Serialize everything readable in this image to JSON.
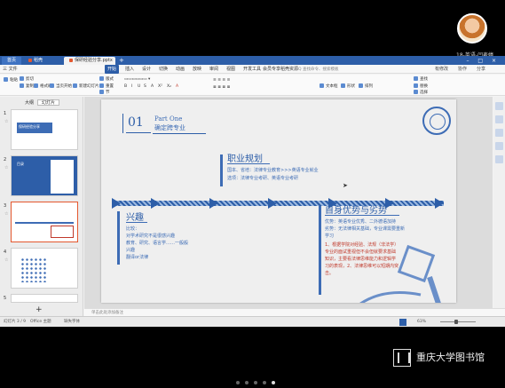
{
  "viewer": {
    "avatar_name": "18-英语-闫麦婷",
    "library_name": "重庆大学图书馆"
  },
  "tabs": {
    "home": "首页",
    "t1": "稻壳",
    "t2": "保研经验分享.pptx"
  },
  "menu": {
    "file": "三 文件",
    "items": [
      "开始",
      "插入",
      "设计",
      "切换",
      "动画",
      "放映",
      "审阅",
      "视图",
      "开发工具",
      "会员专享",
      "稻壳资源"
    ],
    "active": "开始",
    "search_placeholder": "Q 查找命令、搜索模板",
    "right": [
      "有修改",
      "协作",
      "分享"
    ]
  },
  "ribbon": {
    "row1": [
      "粘贴",
      "剪切",
      "复制",
      "格式刷",
      "当页开始",
      "新建幻灯片",
      "版式",
      "重置",
      "节",
      "文本框",
      "形状",
      "排列",
      "查找",
      "替换",
      "选择"
    ],
    "row2": [
      "B",
      "I",
      "U",
      "S",
      "A",
      "X²",
      "X₂",
      "A"
    ]
  },
  "left_panel": {
    "tab_outline": "大纲",
    "tab_slides": "幻灯片",
    "thumbs": [
      {
        "num": "1",
        "label": "保研经验分享"
      },
      {
        "num": "2",
        "label": "目录"
      },
      {
        "num": "3",
        "label": ""
      },
      {
        "num": "4",
        "label": ""
      },
      {
        "num": "5",
        "label": ""
      }
    ],
    "add": "+"
  },
  "slide": {
    "num": "01",
    "part": "Part One",
    "part_title": "确定跨专业",
    "career_title": "职业规划",
    "career_lines": [
      "国本、省培：法律专业教育>>>英语专业就业",
      "选项：法律专业考研、英语专业考研"
    ],
    "interest_title": "兴趣",
    "interest_lines": [
      "比较：",
      "对学术研究不是很感兴趣",
      "教育、研究、语言学……一般般",
      "兴趣",
      "翻译or法律"
    ],
    "strength_title": "自身优势与劣势",
    "strength_lines": [
      "优势：英语专业优秀、二外德语加持",
      "劣势：无法律相关基础，专业课需要重新",
      "学习"
    ],
    "strength_red": [
      "1、根据学院对经验、法规（非法学）",
      "专业的面试重视但不会但就要求基础",
      "知识，主要看法律思维能力和逻辑学",
      "习的表现，2、法律思维可以短期内突",
      "击。"
    ]
  },
  "notes": "单击此处添加备注",
  "status": {
    "left": "幻灯片 3 / 9",
    "theme": "Office 主题",
    "font": "缺失字体",
    "zoom": "63%"
  }
}
